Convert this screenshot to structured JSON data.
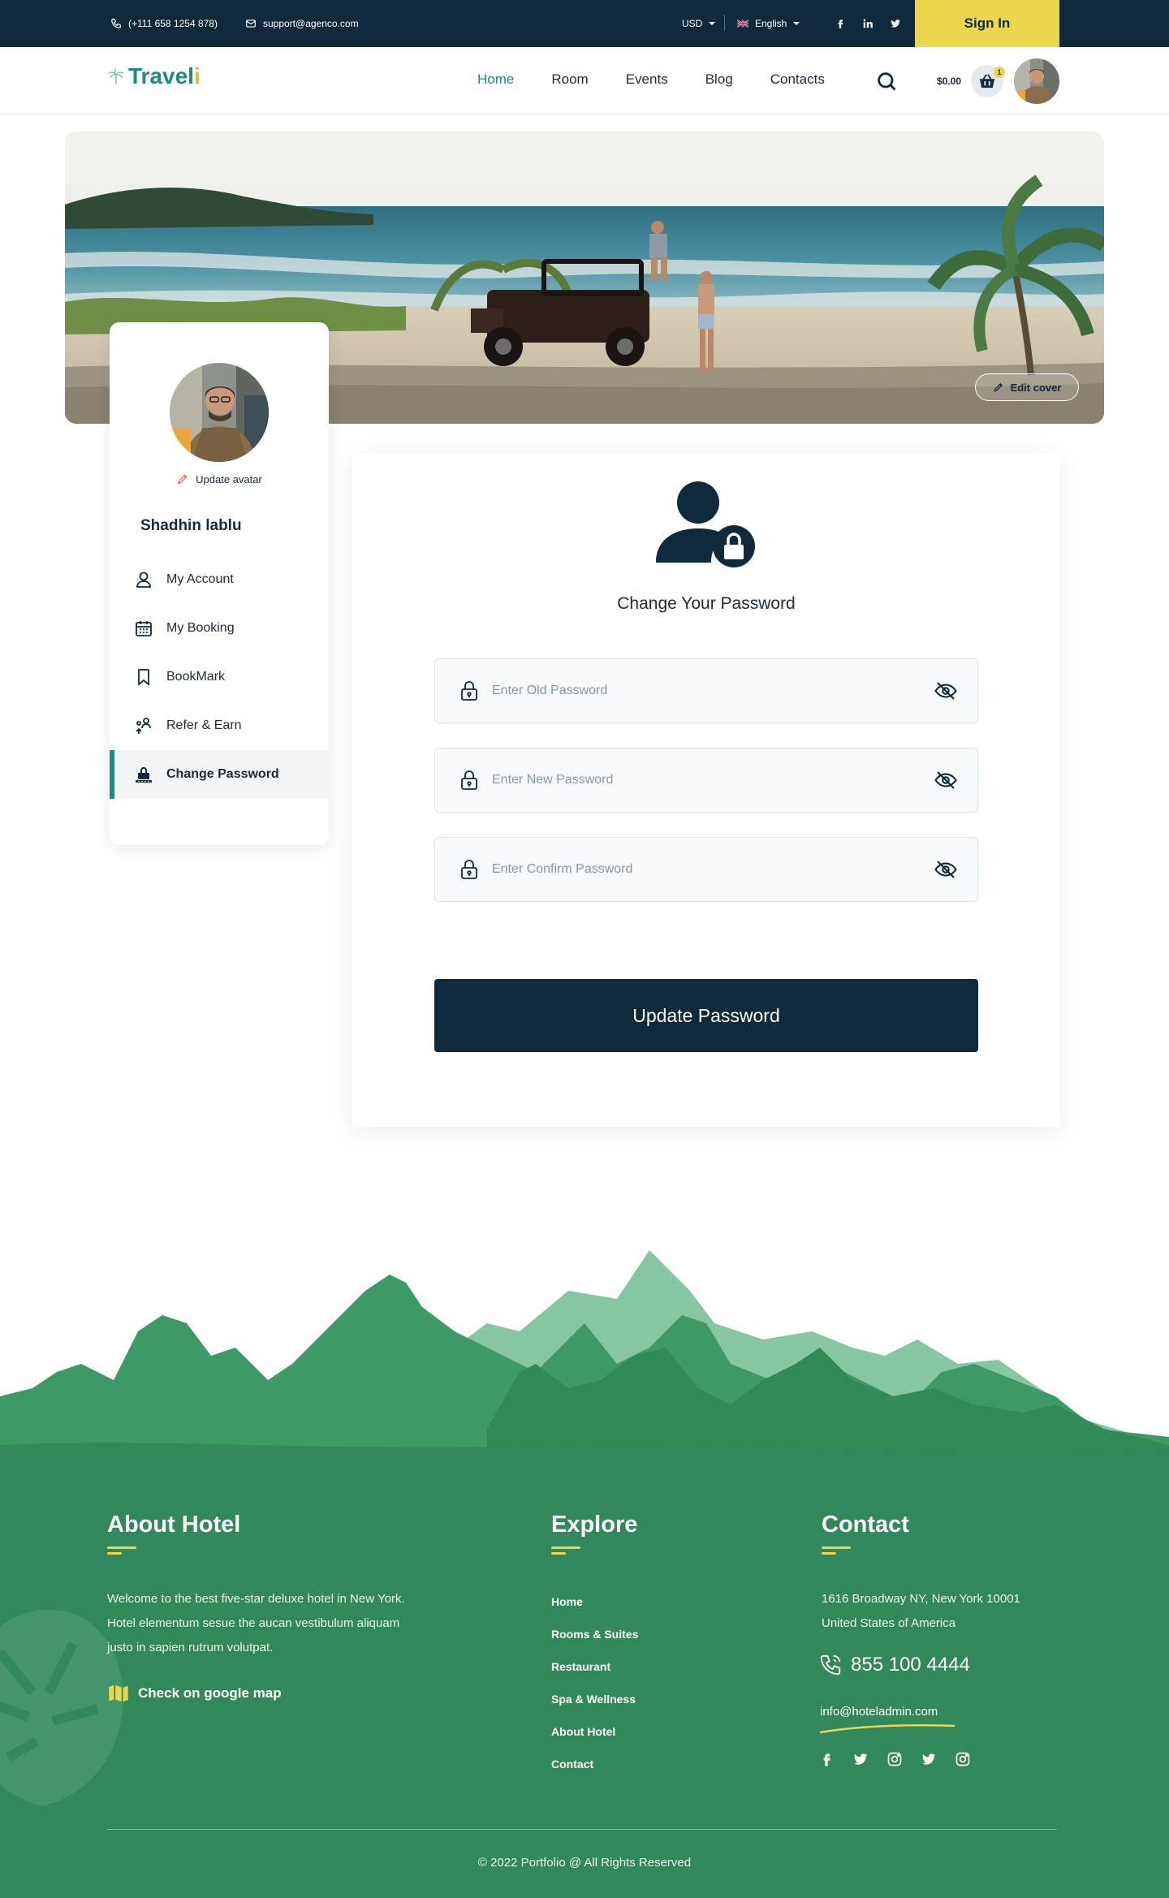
{
  "topbar": {
    "phone": "(+111 658 1254 878)",
    "email": "support@agenco.com",
    "currency": "USD",
    "language": "English",
    "signin_label": "Sign In"
  },
  "nav": {
    "logo_main": "Travel",
    "logo_accent": "i",
    "links": [
      {
        "label": "Home",
        "active": true
      },
      {
        "label": "Room",
        "active": false
      },
      {
        "label": "Events",
        "active": false
      },
      {
        "label": "Blog",
        "active": false
      },
      {
        "label": "Contacts",
        "active": false
      }
    ],
    "cart_total": "$0.00",
    "cart_count": "1"
  },
  "cover": {
    "edit_label": "Edit cover"
  },
  "sidebar": {
    "update_avatar_label": "Update avatar",
    "profile_name": "Shadhin lablu",
    "menu": [
      {
        "label": "My Account",
        "icon": "user-icon"
      },
      {
        "label": "My Booking",
        "icon": "calendar-icon"
      },
      {
        "label": "BookMark",
        "icon": "bookmark-icon"
      },
      {
        "label": "Refer & Earn",
        "icon": "refer-icon"
      },
      {
        "label": "Change Password",
        "icon": "password-icon",
        "active": true
      }
    ]
  },
  "password": {
    "title": "Change Your Password",
    "old_placeholder": "Enter Old Password",
    "new_placeholder": "Enter New Password",
    "confirm_placeholder": "Enter Confirm Password",
    "update_label": "Update Password"
  },
  "footer": {
    "about_title": "About Hotel",
    "about_text": "Welcome to the best five-star deluxe hotel in New York. Hotel elementum sesue the aucan vestibulum aliquam justo in sapien rutrum volutpat.",
    "map_label": "Check on google map",
    "explore_title": "Explore",
    "explore_links": [
      "Home",
      "Rooms & Suites",
      "Restaurant",
      "Spa & Wellness",
      "About Hotel",
      "Contact"
    ],
    "contact_title": "Contact",
    "address_line1": "1616 Broadway NY, New York 10001",
    "address_line2": "United States of America",
    "phone": "855 100 4444",
    "email": "info@hoteladmin.com",
    "copyright": "© 2022 Portfolio @ All Rights Reserved"
  },
  "colors": {
    "navy": "#0e2a3c",
    "teal": "#1f8a7e",
    "yellow": "#ecd64f",
    "footer_green": "#31885a"
  }
}
